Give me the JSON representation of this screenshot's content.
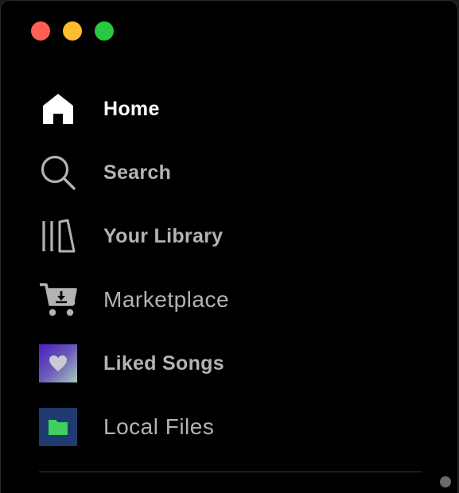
{
  "window": {
    "controls": [
      "close",
      "minimize",
      "zoom"
    ]
  },
  "nav": {
    "items": [
      {
        "label": "Home",
        "icon": "home-icon",
        "active": true
      },
      {
        "label": "Search",
        "icon": "search-icon",
        "active": false
      },
      {
        "label": "Your Library",
        "icon": "library-icon",
        "active": false
      },
      {
        "label": "Marketplace",
        "icon": "cart-download-icon",
        "active": false
      },
      {
        "label": "Liked Songs",
        "icon": "heart-icon",
        "active": false
      },
      {
        "label": "Local Files",
        "icon": "folder-icon",
        "active": false
      }
    ]
  },
  "colors": {
    "background": "#000000",
    "active_text": "#ffffff",
    "inactive_text": "#b3b3b3",
    "close": "#ff5f57",
    "minimize": "#febc2e",
    "zoom": "#28c840",
    "folder_green": "#3ecf5e",
    "local_files_tile": "#1f3a6e"
  }
}
